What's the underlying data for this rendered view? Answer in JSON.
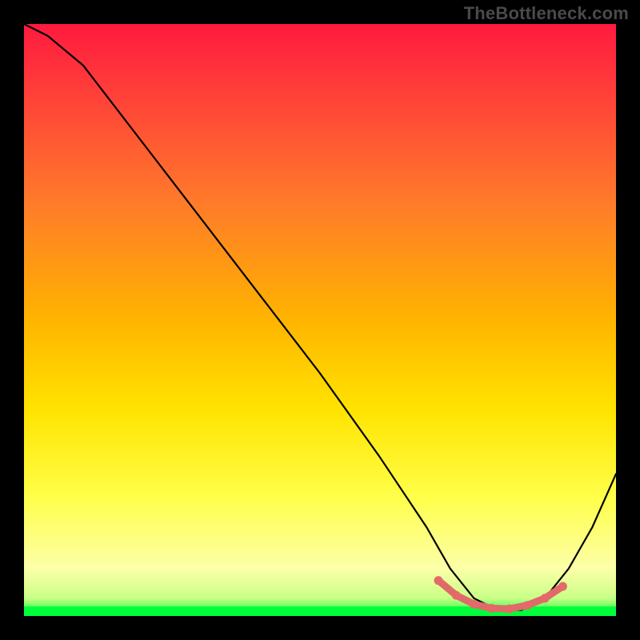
{
  "watermark": "TheBottleneck.com",
  "colors": {
    "black": "#000000",
    "curve": "#000000",
    "marker_fill": "#e46a6a",
    "marker_stroke": "#cf5a5a",
    "band_green": "#00ff3a",
    "grad_top": "#ff1a3f",
    "grad_upper_mid": "#ff7a2a",
    "grad_mid": "#ffd400",
    "grad_lower_mid": "#ffff4a",
    "grad_pale": "#fdffb0",
    "grad_bottom": "#00ff3a"
  },
  "chart_data": {
    "type": "line",
    "title": "",
    "xlabel": "",
    "ylabel": "",
    "xlim": [
      0,
      100
    ],
    "ylim": [
      0,
      100
    ],
    "grid": false,
    "legend": false,
    "note": "Chart has no numeric axes or labels; x/y are estimated in percent of the plot area. y=100 is the top of the colored panel; y=0 is the bottom.",
    "series": [
      {
        "name": "bottleneck-curve",
        "x": [
          0,
          4,
          10,
          20,
          30,
          40,
          50,
          60,
          68,
          72,
          76,
          80,
          84,
          88,
          92,
          96,
          100
        ],
        "y": [
          100,
          98,
          93,
          80,
          67,
          54,
          41,
          27,
          15,
          8,
          3,
          1,
          1,
          3,
          8,
          15,
          24
        ]
      }
    ],
    "markers": {
      "name": "optimal-range",
      "x": [
        70,
        73,
        76,
        79,
        82,
        85,
        88,
        91
      ],
      "y": [
        6,
        3.5,
        2,
        1.3,
        1.2,
        1.8,
        3,
        5
      ]
    }
  }
}
